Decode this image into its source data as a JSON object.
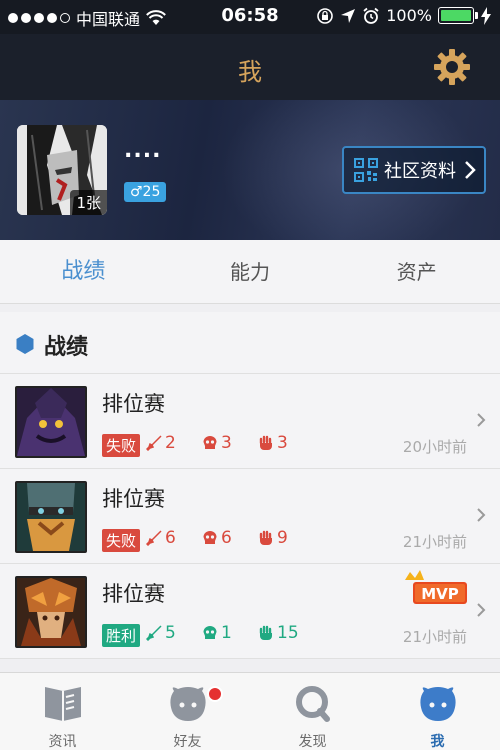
{
  "status_bar": {
    "carrier": "中国联通",
    "time": "06:58",
    "battery": "100%",
    "battery_level": 1.0
  },
  "nav": {
    "title": "我"
  },
  "profile": {
    "nickname": "....",
    "avatar_count": "1张",
    "gender_level": "♂25",
    "community_label": "社区资料"
  },
  "tabs": [
    {
      "label": "战绩"
    },
    {
      "label": "能力"
    },
    {
      "label": "资产"
    }
  ],
  "section": {
    "title": "战绩"
  },
  "matches": [
    {
      "type": "排位赛",
      "result": "失败",
      "kills": "2",
      "deaths": "3",
      "assists": "3",
      "time": "20小时前"
    },
    {
      "type": "排位赛",
      "result": "失败",
      "kills": "6",
      "deaths": "6",
      "assists": "9",
      "time": "21小时前"
    },
    {
      "type": "排位赛",
      "result": "胜利",
      "kills": "5",
      "deaths": "1",
      "assists": "15",
      "time": "21小时前",
      "mvp": "MVP"
    }
  ],
  "tab_bar": [
    {
      "label": "资讯"
    },
    {
      "label": "好友"
    },
    {
      "label": "发现"
    },
    {
      "label": "我"
    }
  ],
  "colors": {
    "accent": "#4a8fcf",
    "lose": "#d94a3e",
    "win": "#20a982",
    "title_gold": "#d6a45c"
  }
}
